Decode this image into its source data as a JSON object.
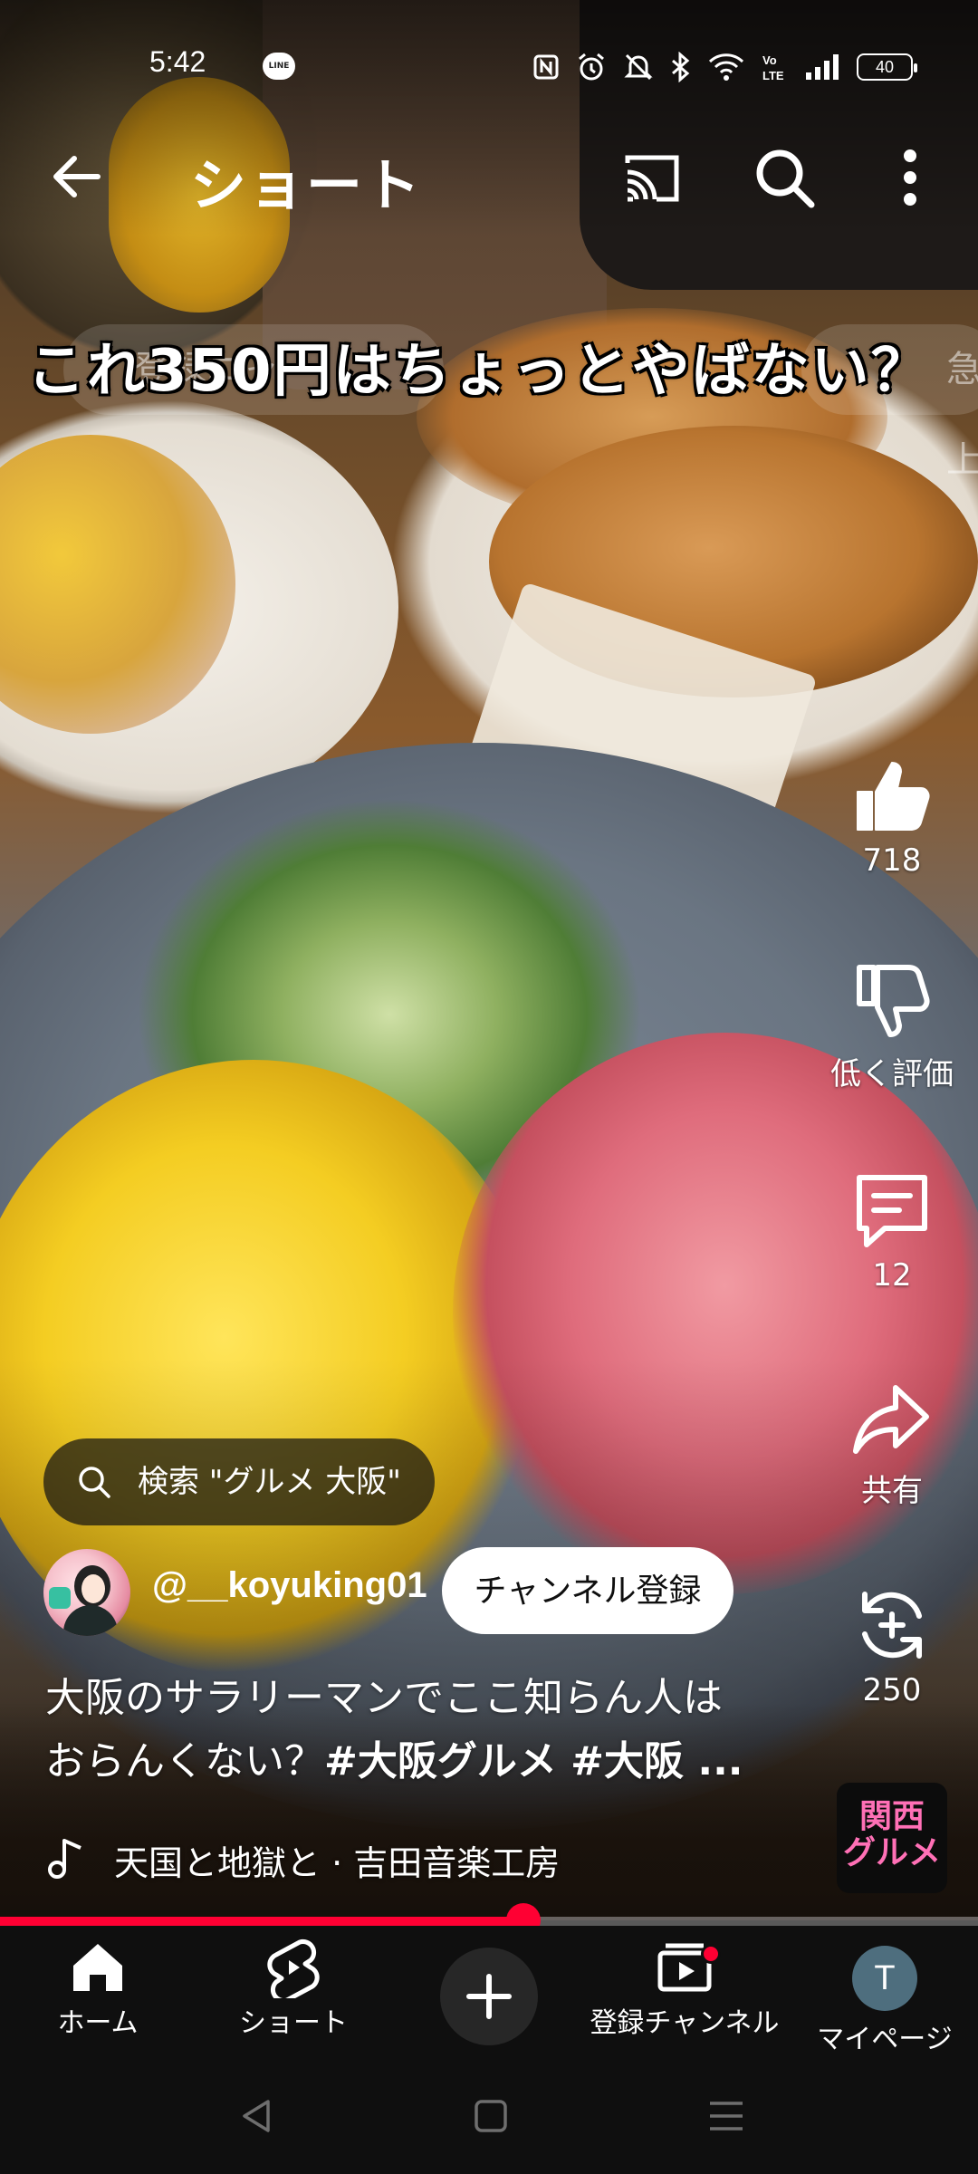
{
  "status_bar": {
    "time": "5:42",
    "notification_app": "LINE",
    "battery": "40",
    "icons": [
      "nfc-icon",
      "alarm-icon",
      "mute-icon",
      "bluetooth-icon",
      "wifi-icon",
      "volte-icon",
      "signal-icon",
      "battery-icon"
    ]
  },
  "top_bar": {
    "title": "ショート",
    "icons": [
      "back-arrow-icon",
      "cast-icon",
      "search-icon",
      "more-vert-icon"
    ]
  },
  "video": {
    "caption_overlay": "これ350円はちょっとやばない？",
    "ghost_chips": [
      "登録ニャ",
      "急上"
    ]
  },
  "actions": {
    "like": {
      "label": "718",
      "icon": "thumbs-up-icon"
    },
    "dislike": {
      "label": "低く評価",
      "icon": "thumbs-down-icon"
    },
    "comments": {
      "label": "12",
      "icon": "comment-icon"
    },
    "share": {
      "label": "共有",
      "icon": "share-icon"
    },
    "remix": {
      "label": "250",
      "icon": "remix-icon"
    }
  },
  "search_chip": {
    "label": "検索 \"グルメ 大阪\""
  },
  "channel": {
    "handle": "@__koyuking01",
    "subscribe_label": "チャンネル登録"
  },
  "description": {
    "line1": "大阪のサラリーマンでここ知らん人は",
    "line2_text": "おらんくない？",
    "line2_tags": "#大阪グルメ #大阪 ..."
  },
  "music": {
    "label": "天国と地獄と · 吉田音楽工房"
  },
  "sound_thumb": {
    "line1": "関西",
    "line2": "グルメ"
  },
  "progress": {
    "fraction": 0.535
  },
  "bottom_nav": {
    "home": "ホーム",
    "shorts": "ショート",
    "subscriptions": "登録チャンネル",
    "profile": "マイページ",
    "profile_initial": "T"
  },
  "colors": {
    "accent_red": "#ff0033",
    "nav_bg": "#0f0f0f",
    "sound_pink": "#ff70b6"
  }
}
